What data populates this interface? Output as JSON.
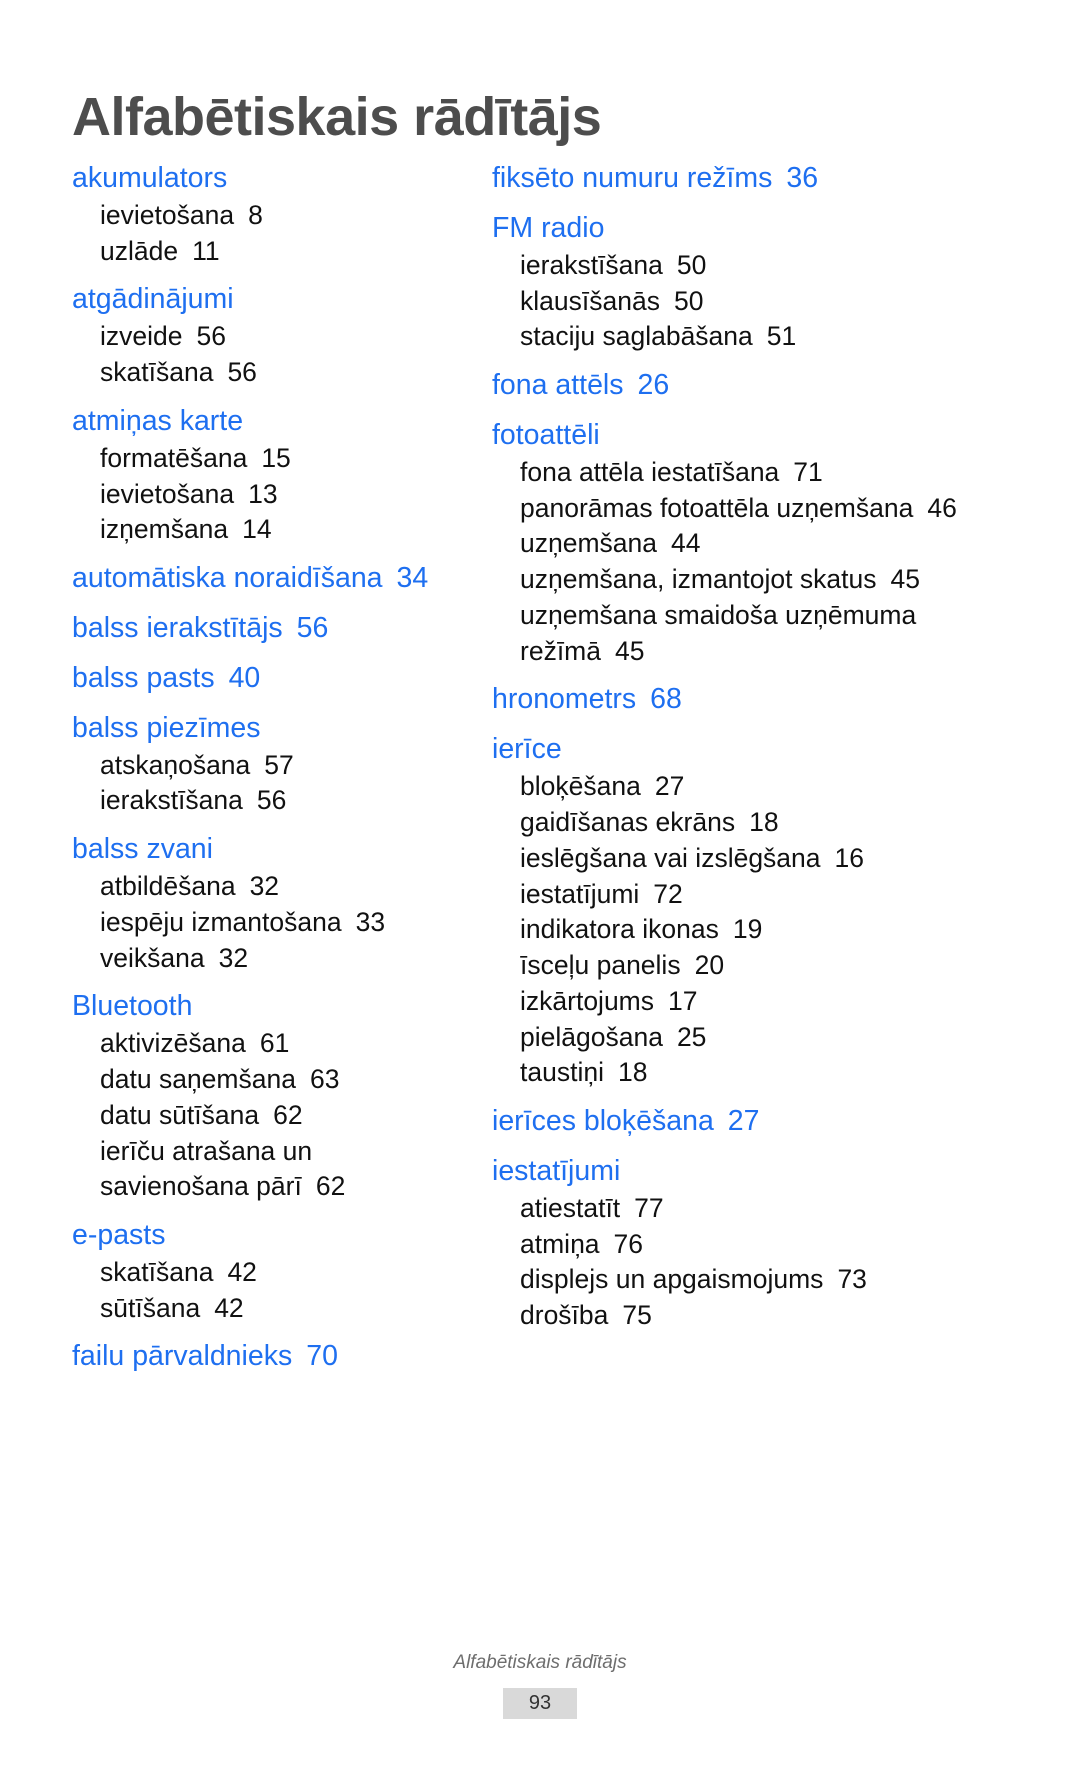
{
  "document": {
    "title": "Alfabētiskais rādītājs",
    "accent_color": "#1e6ff0",
    "title_color": "#4d4d4d",
    "footer": {
      "label": "Alfabētiskais rādītājs",
      "page_number": "93"
    }
  },
  "columns": {
    "left": [
      {
        "term": "akumulators",
        "page": "",
        "subentries": [
          {
            "term": "ievietošana",
            "page": "8"
          },
          {
            "term": "uzlāde",
            "page": "11"
          }
        ]
      },
      {
        "term": "atgādinājumi",
        "page": "",
        "subentries": [
          {
            "term": "izveide",
            "page": "56"
          },
          {
            "term": "skatīšana",
            "page": "56"
          }
        ]
      },
      {
        "term": "atmiņas karte",
        "page": "",
        "subentries": [
          {
            "term": "formatēšana",
            "page": "15"
          },
          {
            "term": "ievietošana",
            "page": "13"
          },
          {
            "term": "izņemšana",
            "page": "14"
          }
        ]
      },
      {
        "term": "automātiska noraidīšana",
        "page": "34",
        "subentries": []
      },
      {
        "term": "balss ierakstītājs",
        "page": "56",
        "subentries": []
      },
      {
        "term": "balss pasts",
        "page": "40",
        "subentries": []
      },
      {
        "term": "balss piezīmes",
        "page": "",
        "subentries": [
          {
            "term": "atskaņošana",
            "page": "57"
          },
          {
            "term": "ierakstīšana",
            "page": "56"
          }
        ]
      },
      {
        "term": "balss zvani",
        "page": "",
        "subentries": [
          {
            "term": "atbildēšana",
            "page": "32"
          },
          {
            "term": "iespēju izmantošana",
            "page": "33"
          },
          {
            "term": "veikšana",
            "page": "32"
          }
        ]
      },
      {
        "term": "Bluetooth",
        "page": "",
        "subentries": [
          {
            "term": "aktivizēšana",
            "page": "61"
          },
          {
            "term": "datu saņemšana",
            "page": "63"
          },
          {
            "term": "datu sūtīšana",
            "page": "62"
          },
          {
            "term": "ierīču atrašana un savienošana pārī",
            "page": "62"
          }
        ]
      },
      {
        "term": "e-pasts",
        "page": "",
        "subentries": [
          {
            "term": "skatīšana",
            "page": "42"
          },
          {
            "term": "sūtīšana",
            "page": "42"
          }
        ]
      },
      {
        "term": "failu pārvaldnieks",
        "page": "70",
        "subentries": []
      }
    ],
    "right": [
      {
        "term": "fiksēto numuru režīms",
        "page": "36",
        "subentries": []
      },
      {
        "term": "FM radio",
        "page": "",
        "subentries": [
          {
            "term": "ierakstīšana",
            "page": "50"
          },
          {
            "term": "klausīšanās",
            "page": "50"
          },
          {
            "term": "staciju saglabāšana",
            "page": "51"
          }
        ]
      },
      {
        "term": "fona attēls",
        "page": "26",
        "subentries": []
      },
      {
        "term": "fotoattēli",
        "page": "",
        "subentries": [
          {
            "term": "fona attēla iestatīšana",
            "page": "71"
          },
          {
            "term": "panorāmas fotoattēla uzņemšana",
            "page": "46"
          },
          {
            "term": "uzņemšana",
            "page": "44"
          },
          {
            "term": "uzņemšana, izmantojot skatus",
            "page": "45"
          },
          {
            "term": "uzņemšana smaidoša uzņēmuma režīmā",
            "page": "45"
          }
        ]
      },
      {
        "term": "hronometrs",
        "page": "68",
        "subentries": []
      },
      {
        "term": "ierīce",
        "page": "",
        "subentries": [
          {
            "term": "bloķēšana",
            "page": "27"
          },
          {
            "term": "gaidīšanas ekrāns",
            "page": "18"
          },
          {
            "term": "ieslēgšana vai izslēgšana",
            "page": "16"
          },
          {
            "term": "iestatījumi",
            "page": "72"
          },
          {
            "term": "indikatora ikonas",
            "page": "19"
          },
          {
            "term": "īsceļu panelis",
            "page": "20"
          },
          {
            "term": "izkārtojums",
            "page": "17"
          },
          {
            "term": "pielāgošana",
            "page": "25"
          },
          {
            "term": "taustiņi",
            "page": "18"
          }
        ]
      },
      {
        "term": "ierīces bloķēšana",
        "page": "27",
        "subentries": []
      },
      {
        "term": "iestatījumi",
        "page": "",
        "subentries": [
          {
            "term": "atiestatīt",
            "page": "77"
          },
          {
            "term": "atmiņa",
            "page": "76"
          },
          {
            "term": "displejs un apgaismojums",
            "page": "73"
          },
          {
            "term": "drošība",
            "page": "75"
          }
        ]
      }
    ]
  }
}
